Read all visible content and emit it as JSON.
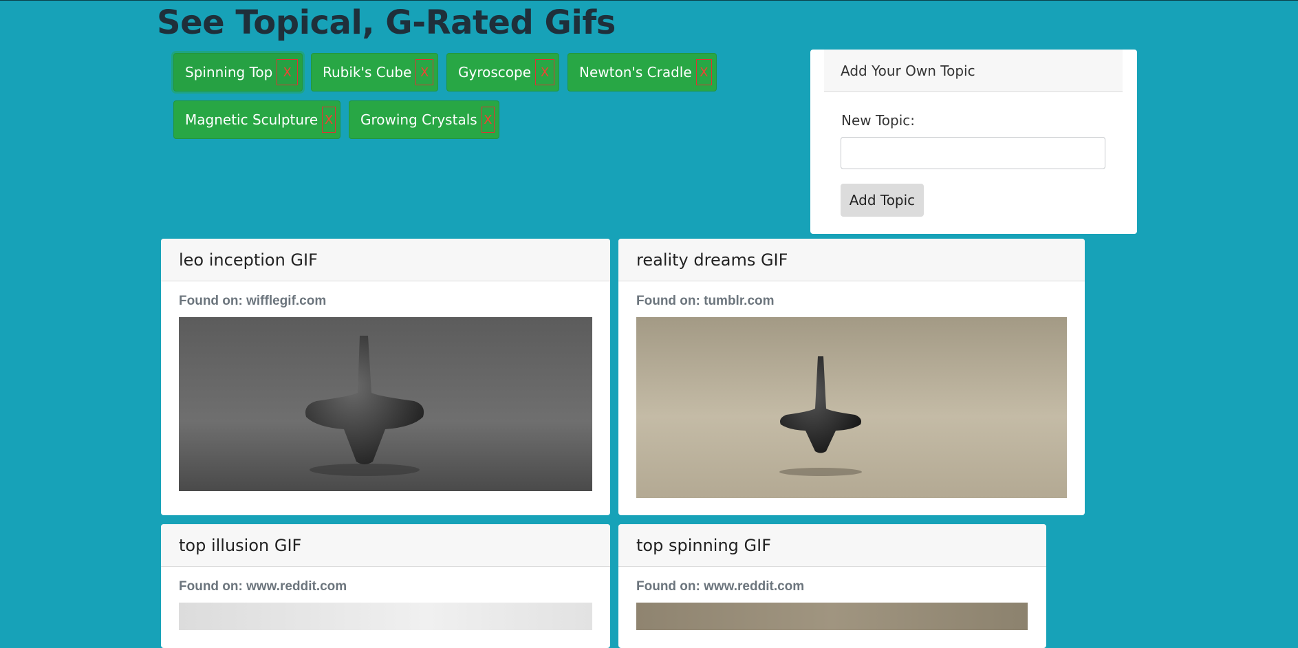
{
  "page": {
    "title": "See Topical, G-Rated Gifs"
  },
  "topics": [
    {
      "label": "Spinning Top",
      "remove_label": "X"
    },
    {
      "label": "Rubik's Cube",
      "remove_label": "X"
    },
    {
      "label": "Gyroscope",
      "remove_label": "X"
    },
    {
      "label": "Newton's Cradle",
      "remove_label": "X"
    },
    {
      "label": "Magnetic Sculpture",
      "remove_label": "X"
    },
    {
      "label": "Growing Crystals",
      "remove_label": "X"
    }
  ],
  "add_panel": {
    "header": "Add Your Own Topic",
    "field_label": "New Topic:",
    "input_value": "",
    "button_label": "Add Topic"
  },
  "gifs": [
    {
      "title": "leo inception GIF",
      "source": "Found on: wifflegif.com"
    },
    {
      "title": "reality dreams GIF",
      "source": "Found on: tumblr.com"
    },
    {
      "title": "top illusion GIF",
      "source": "Found on: www.reddit.com"
    },
    {
      "title": "top spinning GIF",
      "source": "Found on: www.reddit.com"
    }
  ],
  "colors": {
    "background": "#17a2b8",
    "topic_button": "#28a745",
    "remove_border": "#dd3333"
  }
}
